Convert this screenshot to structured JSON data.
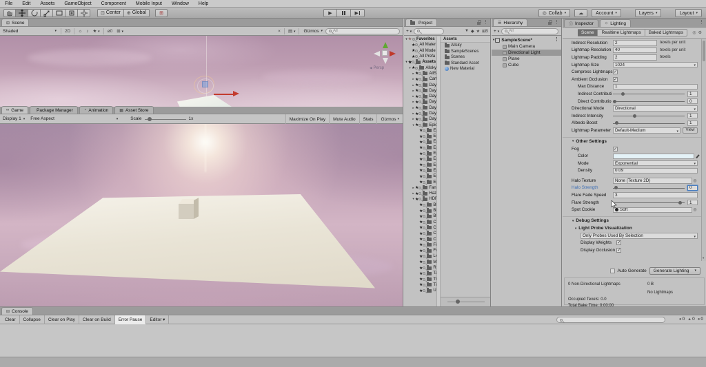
{
  "menu": {
    "items": [
      "File",
      "Edit",
      "Assets",
      "GameObject",
      "Component",
      "Mobile Input",
      "Window",
      "Help"
    ]
  },
  "toolbar": {
    "center_label": "Center",
    "global_label": "Global",
    "collab_label": "Collab",
    "account_label": "Account",
    "layers_label": "Layers",
    "layout_label": "Layout",
    "cloud_icon": "☁",
    "collab_icon": "◎"
  },
  "scene": {
    "tab": "Scene",
    "tab_icon": "⊞",
    "draw_mode": "Shaded",
    "mode_2d": "2D",
    "icons": {
      "lighting": "☼",
      "audio": "♪",
      "effects": "★",
      "visibility": "ø0",
      "grid": "⊞",
      "tools": "×",
      "camera": "▤"
    },
    "gizmos_label": "Gizmos",
    "search_placeholder": "All",
    "persp_label": "Persp"
  },
  "game": {
    "tabs": [
      {
        "label": "Game",
        "icon": "∞",
        "selected": true
      },
      {
        "label": "Package Manager",
        "icon": ""
      },
      {
        "label": "Animation",
        "icon": "◔"
      },
      {
        "label": "Asset Store",
        "icon": "▦"
      }
    ],
    "display": "Display 1",
    "aspect": "Free Aspect",
    "scale_label": "Scale",
    "scale_value": "1x",
    "maximize_label": "Maximize On Play",
    "mute_label": "Mute Audio",
    "stats_label": "Stats",
    "gizmos_label": "Gizmos"
  },
  "project": {
    "tab": "Project",
    "col_header": "Assets",
    "tree": [
      {
        "label": "Favorites",
        "depth": 0,
        "type": "fav"
      },
      {
        "label": "All Mater",
        "depth": 1,
        "type": "search"
      },
      {
        "label": "All Mode",
        "depth": 1,
        "type": "search"
      },
      {
        "label": "All Prefa",
        "depth": 1,
        "type": "search"
      },
      {
        "label": "Assets",
        "depth": 0,
        "type": "root"
      },
      {
        "label": "Allsky",
        "depth": 1,
        "type": "open"
      },
      {
        "label": "AllSky",
        "depth": 2,
        "type": "closed"
      },
      {
        "label": "Cartoo",
        "depth": 2,
        "type": "closed"
      },
      {
        "label": "Day S",
        "depth": 2,
        "type": "closed"
      },
      {
        "label": "Day S",
        "depth": 2,
        "type": "closed"
      },
      {
        "label": "Day S",
        "depth": 2,
        "type": "closed"
      },
      {
        "label": "Day S",
        "depth": 2,
        "type": "closed"
      },
      {
        "label": "Day S",
        "depth": 2,
        "type": "closed"
      },
      {
        "label": "Day S",
        "depth": 2,
        "type": "closed"
      },
      {
        "label": "Day T",
        "depth": 2,
        "type": "closed"
      },
      {
        "label": "Epic",
        "depth": 2,
        "type": "open"
      },
      {
        "label": "Epi",
        "depth": 3,
        "type": "leaf"
      },
      {
        "label": "Epi",
        "depth": 3,
        "type": "leaf"
      },
      {
        "label": "Epi",
        "depth": 3,
        "type": "leaf"
      },
      {
        "label": "Epi",
        "depth": 3,
        "type": "leaf"
      },
      {
        "label": "Epi",
        "depth": 3,
        "type": "leaf"
      },
      {
        "label": "Epi",
        "depth": 3,
        "type": "leaf"
      },
      {
        "label": "Epi",
        "depth": 3,
        "type": "leaf"
      },
      {
        "label": "Epi",
        "depth": 3,
        "type": "leaf"
      },
      {
        "label": "Epi",
        "depth": 3,
        "type": "leaf"
      },
      {
        "label": "Epi",
        "depth": 3,
        "type": "leaf"
      },
      {
        "label": "Fanta",
        "depth": 2,
        "type": "closed"
      },
      {
        "label": "Haze",
        "depth": 2,
        "type": "closed"
      },
      {
        "label": "HDRI",
        "depth": 2,
        "type": "open"
      },
      {
        "label": "Blo",
        "depth": 3,
        "type": "leaf"
      },
      {
        "label": "Blo",
        "depth": 3,
        "type": "leaf"
      },
      {
        "label": "Blu",
        "depth": 3,
        "type": "leaf"
      },
      {
        "label": "Cay",
        "depth": 3,
        "type": "leaf"
      },
      {
        "label": "Cec",
        "depth": 3,
        "type": "leaf"
      },
      {
        "label": "Cir",
        "depth": 3,
        "type": "leaf"
      },
      {
        "label": "Clo",
        "depth": 3,
        "type": "leaf"
      },
      {
        "label": "Fish",
        "depth": 3,
        "type": "leaf"
      },
      {
        "label": "Fun",
        "depth": 3,
        "type": "leaf"
      },
      {
        "label": "Len",
        "depth": 3,
        "type": "leaf"
      },
      {
        "label": "Mu",
        "depth": 3,
        "type": "leaf"
      },
      {
        "label": "Roc",
        "depth": 3,
        "type": "leaf"
      },
      {
        "label": "Tab",
        "depth": 3,
        "type": "leaf"
      },
      {
        "label": "The",
        "depth": 3,
        "type": "leaf"
      },
      {
        "label": "Tib",
        "depth": 3,
        "type": "leaf"
      },
      {
        "label": "Um",
        "depth": 3,
        "type": "leaf"
      }
    ],
    "assets": [
      {
        "label": "Allsky",
        "type": "folder"
      },
      {
        "label": "SampleScenes",
        "type": "folder"
      },
      {
        "label": "Scenes",
        "type": "folder"
      },
      {
        "label": "Standard Asset",
        "type": "folder"
      },
      {
        "label": "New Material",
        "type": "material"
      }
    ]
  },
  "hierarchy": {
    "tab": "Hierarchy",
    "search_placeholder": "All",
    "scene_item": "SampleScene*",
    "items": [
      {
        "label": "Main Camera"
      },
      {
        "label": "Directional Light",
        "selected": true
      },
      {
        "label": "Plane"
      },
      {
        "label": "Cube"
      }
    ]
  },
  "lighting": {
    "tab_inspector": "Inspector",
    "tab_lighting": "Lighting",
    "inspector_icon": "ⓘ",
    "lighting_icon": "☼",
    "subtabs": [
      {
        "label": "Scene",
        "selected": true
      },
      {
        "label": "Realtime Lightmaps"
      },
      {
        "label": "Baked Lightmaps"
      }
    ],
    "help_icon": "◎",
    "gear_icon": "⚙",
    "indirect_resolution": {
      "label": "Indirect Resolution",
      "value": "2",
      "unit": "texels per unit"
    },
    "lightmap_resolution": {
      "label": "Lightmap Resolution",
      "value": "40",
      "unit": "texels per unit"
    },
    "lightmap_padding": {
      "label": "Lightmap Padding",
      "value": "2",
      "unit": "texels"
    },
    "lightmap_size": {
      "label": "Lightmap Size",
      "value": "1024"
    },
    "compress_lightmaps": {
      "label": "Compress Lightmaps",
      "check": "✓"
    },
    "ambient_occlusion": {
      "label": "Ambient Occlusion",
      "check": "✓"
    },
    "max_distance": {
      "label": "Max Distance",
      "value": "1"
    },
    "indirect_contribution": {
      "label": "Indirect Contributi",
      "value": "1",
      "pct": 13
    },
    "direct_contribution": {
      "label": "Direct Contributio",
      "value": "0",
      "pct": 2
    },
    "directional_mode": {
      "label": "Directional Mode",
      "value": "Directional"
    },
    "indirect_intensity": {
      "label": "Indirect Intensity",
      "value": "1",
      "pct": 30
    },
    "albedo_boost": {
      "label": "Albedo Boost",
      "value": "1",
      "pct": 5
    },
    "lightmap_parameters": {
      "label": "Lightmap Parameter",
      "value": "Default-Medium",
      "button": "View"
    },
    "other_settings": "Other Settings",
    "fog": {
      "label": "Fog",
      "check": "✓"
    },
    "fog_color": {
      "label": "Color",
      "swatch": "#e4f2f7"
    },
    "fog_mode": {
      "label": "Mode",
      "value": "Exponential"
    },
    "fog_density": {
      "label": "Density",
      "value": "0.09"
    },
    "halo_texture": {
      "label": "Halo Texture",
      "value": "None (Texture 2D)"
    },
    "halo_strength": {
      "label": "Halo Strength",
      "value": "0",
      "pct": 4
    },
    "flare_fade_speed": {
      "label": "Flare Fade Speed",
      "value": "3"
    },
    "flare_strength": {
      "label": "Flare Strength",
      "value": "1",
      "pct": 93
    },
    "spot_cookie": {
      "label": "Spot Cookie",
      "value": "Soft"
    },
    "debug_settings": "Debug Settings",
    "light_probe_visualization": "Light Probe Visualization",
    "probe_mode": "Only Probes Used By Selection",
    "display_weights": {
      "label": "Display Weights",
      "check": "✓"
    },
    "display_occlusion": {
      "label": "Display Occlusion",
      "check": "✓"
    },
    "auto_generate_label": "Auto Generate",
    "generate_button": "Generate Lighting",
    "stats": {
      "lightmaps": "0 Non-Directional Lightmaps",
      "size": "0 B",
      "no_lightmaps": "No Lightmaps",
      "occupied": "Occupied Texels: 0.0",
      "bake_time": "Total Bake Time: 0:00:00"
    }
  },
  "console": {
    "tab": "Console",
    "buttons": [
      {
        "label": "Clear"
      },
      {
        "label": "Collapse"
      },
      {
        "label": "Clear on Play"
      },
      {
        "label": "Clear on Build"
      },
      {
        "label": "Error Pause",
        "selected": true
      },
      {
        "label": "Editor ▾"
      }
    ],
    "counts": [
      {
        "icon": "●",
        "value": "0",
        "type": "info"
      },
      {
        "icon": "▲",
        "value": "0",
        "type": "warn"
      },
      {
        "icon": "●",
        "value": "0",
        "type": "error"
      }
    ]
  }
}
